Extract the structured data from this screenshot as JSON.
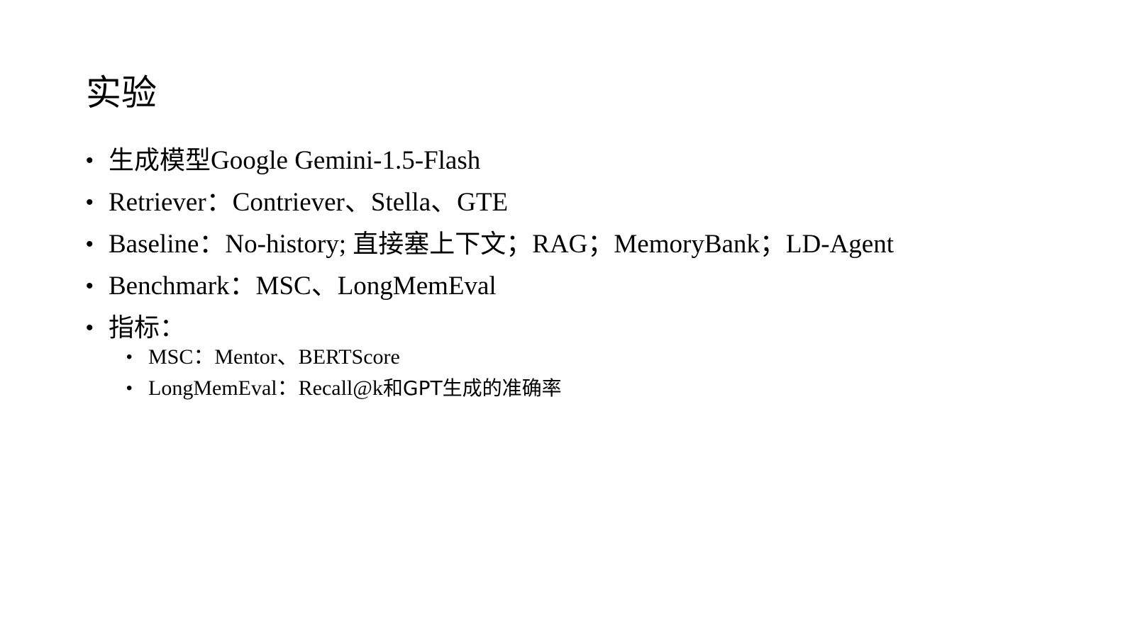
{
  "slide": {
    "title": "实验",
    "bullets": [
      {
        "zh": "生成模型",
        "text": "Google Gemini-1.5-Flash"
      },
      {
        "text": "Retriever：Contriever、Stella、GTE"
      },
      {
        "text_a": "Baseline：No-history; ",
        "zh": "直接塞上下文",
        "text_b": "；RAG；MemoryBank；LD-Agent"
      },
      {
        "text": "Benchmark：MSC、LongMemEval"
      },
      {
        "zh": "指标："
      }
    ],
    "sub_bullets": [
      {
        "text": "MSC：Mentor、BERTScore"
      },
      {
        "text": "LongMemEval：Recall@k",
        "zh": "和GPT生成的准确率"
      }
    ],
    "bullet_char": "•"
  }
}
